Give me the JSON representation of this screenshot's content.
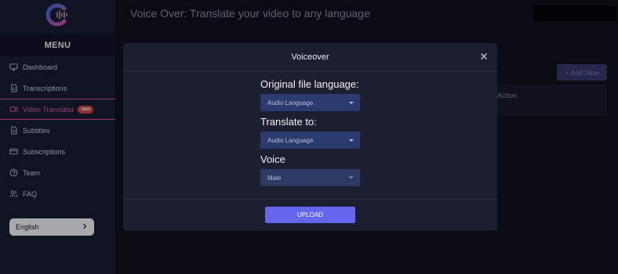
{
  "sidebar": {
    "menu_label": "MENU",
    "items": [
      {
        "label": "Dashboard",
        "icon": "monitor-icon"
      },
      {
        "label": "Transcriptions",
        "icon": "document-icon"
      },
      {
        "label": "Video Translator",
        "icon": "video-icon",
        "badge": "new",
        "active": true
      },
      {
        "label": "Subtitles",
        "icon": "document-icon"
      },
      {
        "label": "Subscriptions",
        "icon": "card-icon"
      },
      {
        "label": "Team",
        "icon": "help-circle-icon"
      },
      {
        "label": "FAQ",
        "icon": "users-icon"
      }
    ],
    "language": "English"
  },
  "main": {
    "title": "Voice Over: Translate your video to any language",
    "add_new_label": "+ Add New",
    "action_column": "Action"
  },
  "modal": {
    "title": "Voiceover",
    "original_label": "Original file language:",
    "original_value": "Audio Language",
    "translate_label": "Translate to:",
    "translate_value": "Audio Language",
    "voice_label": "Voice",
    "voice_value": "Male",
    "upload_label": "UPLOAD"
  },
  "colors": {
    "accent": "#6566ee",
    "active_nav": "#e85d9a",
    "badge": "#e0483f",
    "select_bg": "#2b3b6f"
  }
}
